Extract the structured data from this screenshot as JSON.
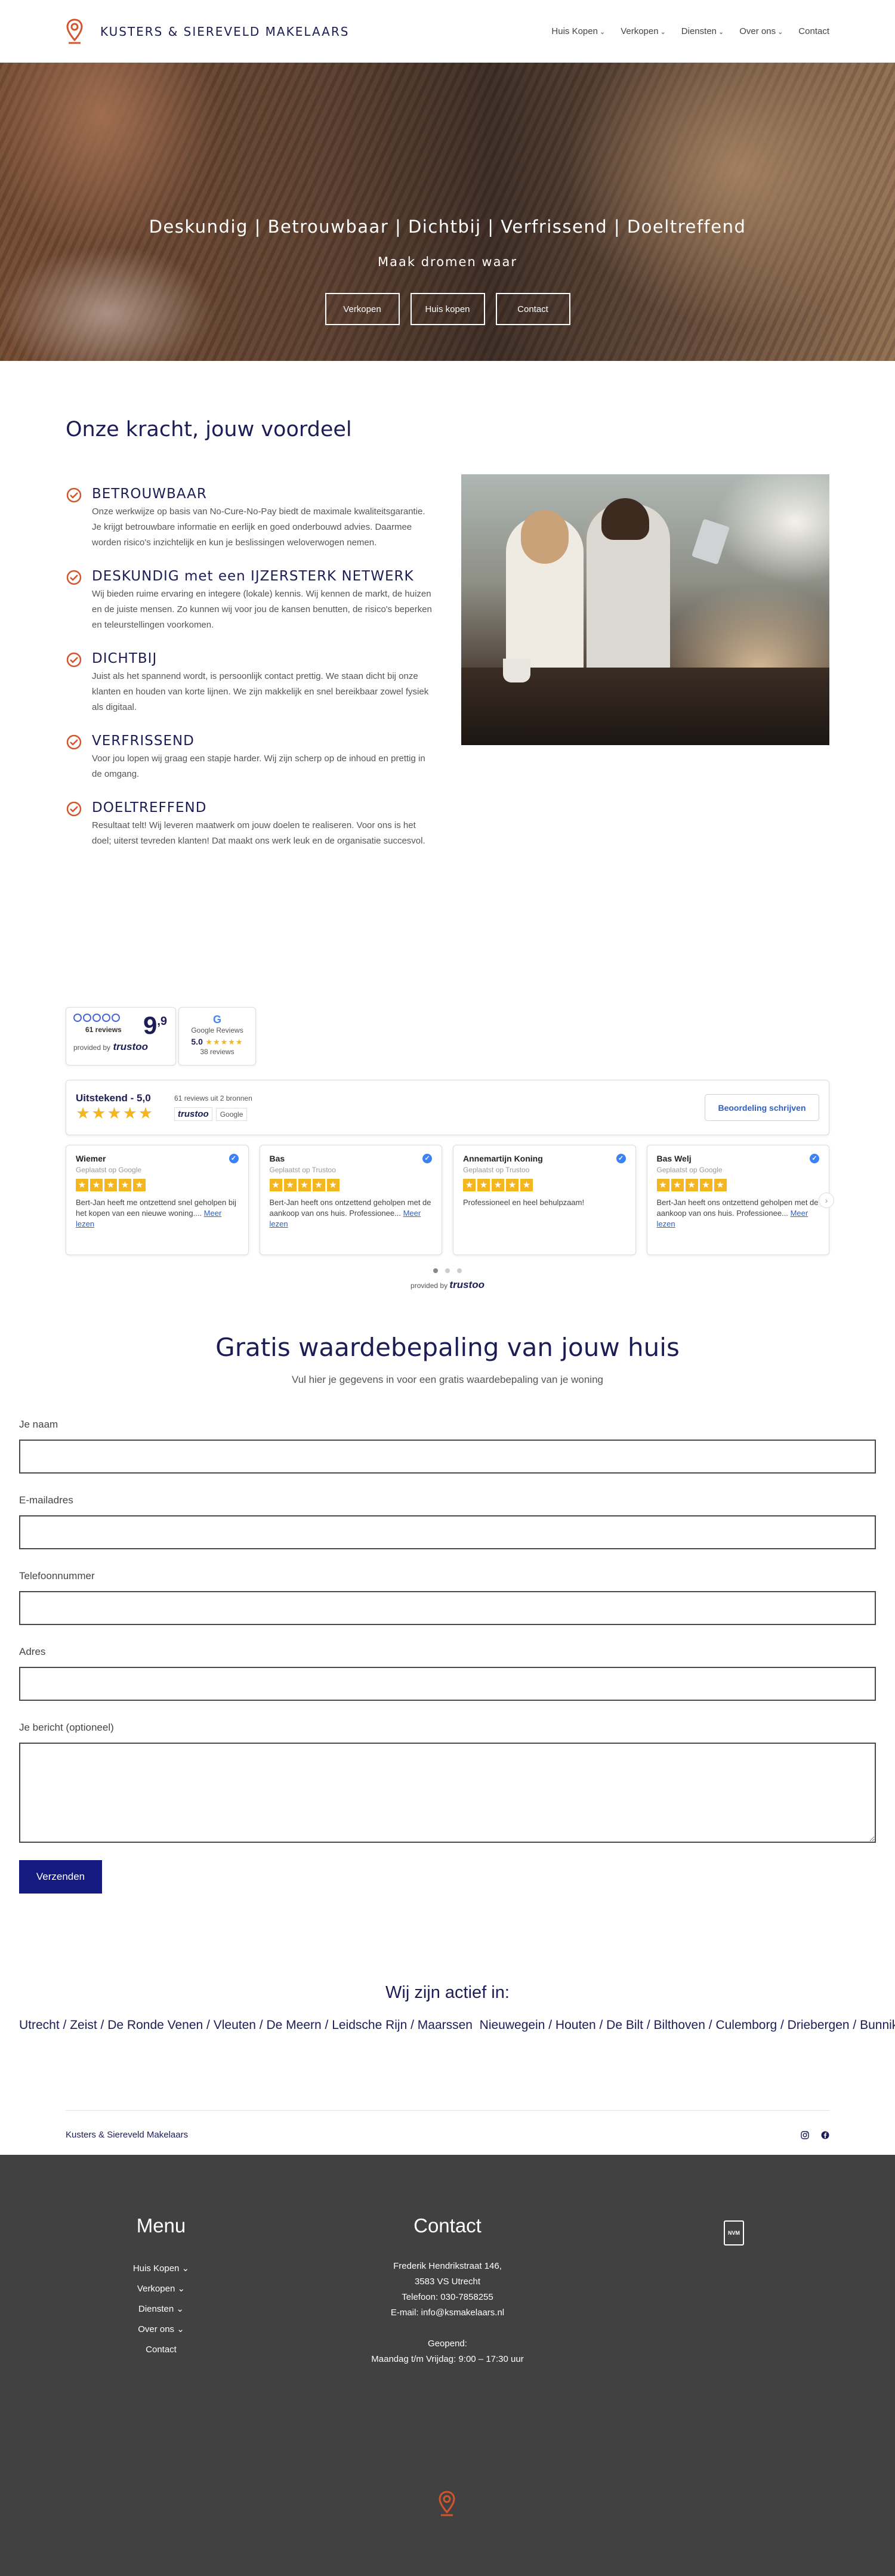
{
  "header": {
    "brand": "KUSTERS & SIEREVELD MAKELAARS",
    "nav": [
      {
        "label": "Huis Kopen",
        "dropdown": true
      },
      {
        "label": "Verkopen",
        "dropdown": true
      },
      {
        "label": "Diensten",
        "dropdown": true
      },
      {
        "label": "Over ons",
        "dropdown": true
      },
      {
        "label": "Contact",
        "dropdown": false
      }
    ]
  },
  "hero": {
    "title": "Deskundig | Betrouwbaar | Dichtbij | Verfrissend | Doeltreffend",
    "subtitle": "Maak dromen waar",
    "buttons": [
      "Verkopen",
      "Huis kopen",
      "Contact"
    ]
  },
  "kracht": {
    "title": "Onze kracht, jouw voordeel",
    "items": [
      {
        "title": "BETROUWBAAR",
        "text": "Onze werkwijze op basis van No-Cure-No-Pay biedt de maximale kwaliteitsgarantie. Je krijgt betrouwbare informatie en eerlijk en goed onderbouwd advies. Daarmee worden risico's inzichtelijk en kun je beslissingen weloverwogen nemen."
      },
      {
        "title": "DESKUNDIG met een IJZERSTERK NETWERK",
        "text": "Wij bieden ruime ervaring en integere (lokale) kennis. Wij kennen de markt, de huizen en de juiste mensen. Zo kunnen wij voor jou de kansen benutten, de risico's beperken en teleurstellingen voorkomen."
      },
      {
        "title": "DICHTBIJ",
        "text": "Juist als het spannend wordt, is persoonlijk contact prettig. We staan dicht bij onze klanten en houden van korte lijnen. We zijn makkelijk en snel bereikbaar zowel fysiek als digitaal."
      },
      {
        "title": "VERFRISSEND",
        "text": "Voor jou lopen wij graag een stapje harder. Wij zijn scherp op de inhoud en prettig in de omgang."
      },
      {
        "title": "DOELTREFFEND",
        "text": "Resultaat telt! Wij leveren maatwerk om jouw doelen te realiseren. Voor ons is het doel; uiterst tevreden klanten! Dat maakt ons werk leuk en de organisatie succesvol."
      }
    ]
  },
  "reviews": {
    "badge_trustoo": {
      "score": "9",
      "score_decimal": ",9",
      "count": "61 reviews",
      "provided": "provided by",
      "logo": "trustoo"
    },
    "badge_google": {
      "title": "Google Reviews",
      "score": "5.0",
      "count": "38 reviews"
    },
    "summary": {
      "label": "Uitstekend - 5,0",
      "count_text": "61 reviews uit 2 bronnen",
      "logo1": "trustoo",
      "logo2": "Google",
      "write_button": "Beoordeling schrijven"
    },
    "cards": [
      {
        "name": "Wiemer",
        "source": "Geplaatst op Google",
        "text": "Bert-Jan heeft me ontzettend snel geholpen bij het kopen van een nieuwe woning....",
        "more": "Meer lezen"
      },
      {
        "name": "Bas",
        "source": "Geplaatst op Trustoo",
        "text": "Bert-Jan heeft ons ontzettend geholpen met de aankoop van ons huis. Professionee...",
        "more": "Meer lezen"
      },
      {
        "name": "Annemartijn Koning",
        "source": "Geplaatst op Trustoo",
        "text": "Professioneel en heel behulpzaam!",
        "more": ""
      },
      {
        "name": "Bas Welj",
        "source": "Geplaatst op Google",
        "text": "Bert-Jan heeft ons ontzettend geholpen met de aankoop van ons huis. Professionee...",
        "more": "Meer lezen"
      }
    ],
    "provided_by": "provided by",
    "provided_logo": "trustoo"
  },
  "waarde": {
    "title": "Gratis waardebepaling van jouw huis",
    "subtitle": "Vul hier je gegevens in voor een gratis waardebepaling van je woning",
    "fields": [
      "Je naam",
      "E-mailadres",
      "Telefoonnummer",
      "Adres",
      "Je bericht (optioneel)"
    ],
    "submit": "Verzenden"
  },
  "actief": {
    "title": "Wij zijn actief in:",
    "cities": [
      "Utrecht",
      "Zeist",
      "De Ronde Venen",
      "Vleuten",
      "De Meern",
      "Leidsche Rijn",
      "Maarssen",
      "Nieuwegein",
      "Houten",
      "De Bilt",
      "Bilthoven",
      "Culemborg",
      "Driebergen",
      "Bunnik"
    ]
  },
  "subfooter": {
    "brand": "Kusters & Siereveld Makelaars"
  },
  "footer": {
    "menu_title": "Menu",
    "menu": [
      "Huis Kopen",
      "Verkopen",
      "Diensten",
      "Over ons",
      "Contact"
    ],
    "contact_title": "Contact",
    "contact_lines": [
      "Frederik Hendrikstraat 146,",
      "3583 VS Utrecht",
      "Telefoon: 030-7858255",
      "E-mail: info@ksmakelaars.nl",
      "",
      "Geopend:",
      "Maandag t/m Vrijdag: 9:00 – 17:30 uur"
    ],
    "badge": "NVM"
  },
  "colors": {
    "brand_navy": "#1d1d55",
    "accent_orange": "#d2552c",
    "button_blue": "#141a80",
    "star_yellow": "#f3b61f",
    "footer_bg": "#414141"
  }
}
